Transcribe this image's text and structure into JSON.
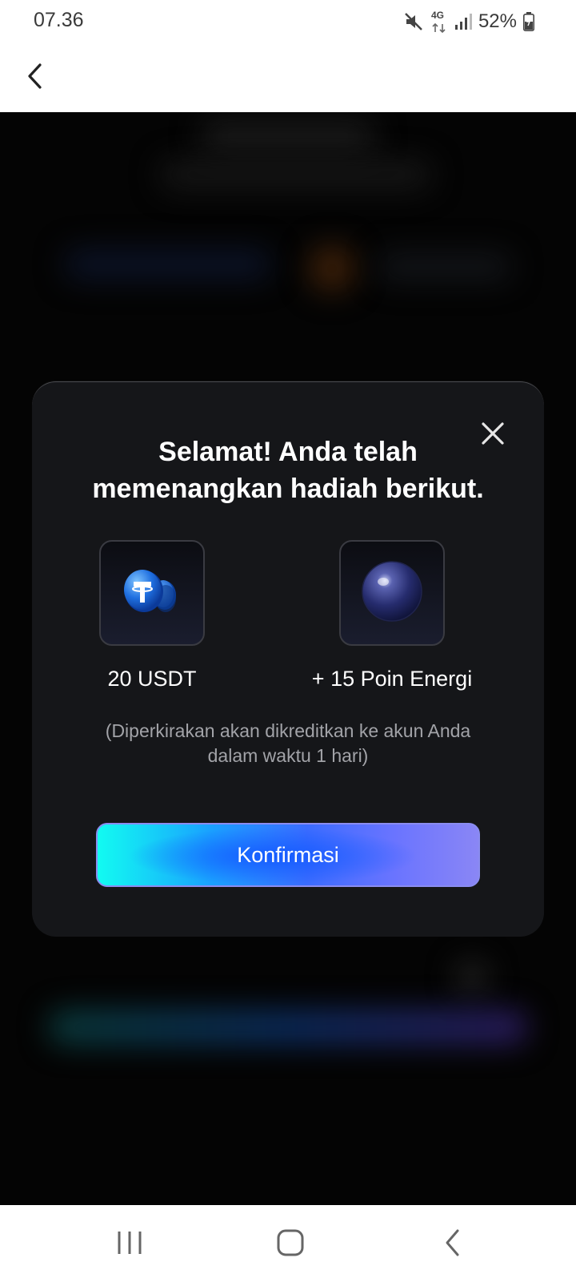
{
  "status_bar": {
    "time": "07.36",
    "network": "4G",
    "battery": "52%",
    "icons": [
      "mute-icon",
      "network-4g-icon",
      "signal-icon",
      "battery-icon"
    ]
  },
  "header": {
    "back_icon": "chevron-left-icon"
  },
  "modal": {
    "title_line1": "Selamat! Anda telah",
    "title_line2": "memenangkan hadiah berikut.",
    "close_icon": "close-icon",
    "rewards": [
      {
        "icon": "usdt-coin-icon",
        "label": "20 USDT"
      },
      {
        "icon": "energy-orb-icon",
        "label": "+ 15 Poin Energi"
      }
    ],
    "note_line1": "(Diperkirakan akan dikreditkan ke akun Anda",
    "note_line2": "dalam waktu 1 hari)",
    "confirm_label": "Konfirmasi"
  },
  "nav_bar": {
    "items": [
      "recent-apps-icon",
      "home-icon",
      "back-icon"
    ]
  },
  "colors": {
    "modal_bg": "#151619",
    "button_gradient_start": "#12fbf1",
    "button_gradient_mid": "#3b6cff",
    "button_gradient_end": "#8a86f5",
    "note_text": "#a2a3a8"
  }
}
